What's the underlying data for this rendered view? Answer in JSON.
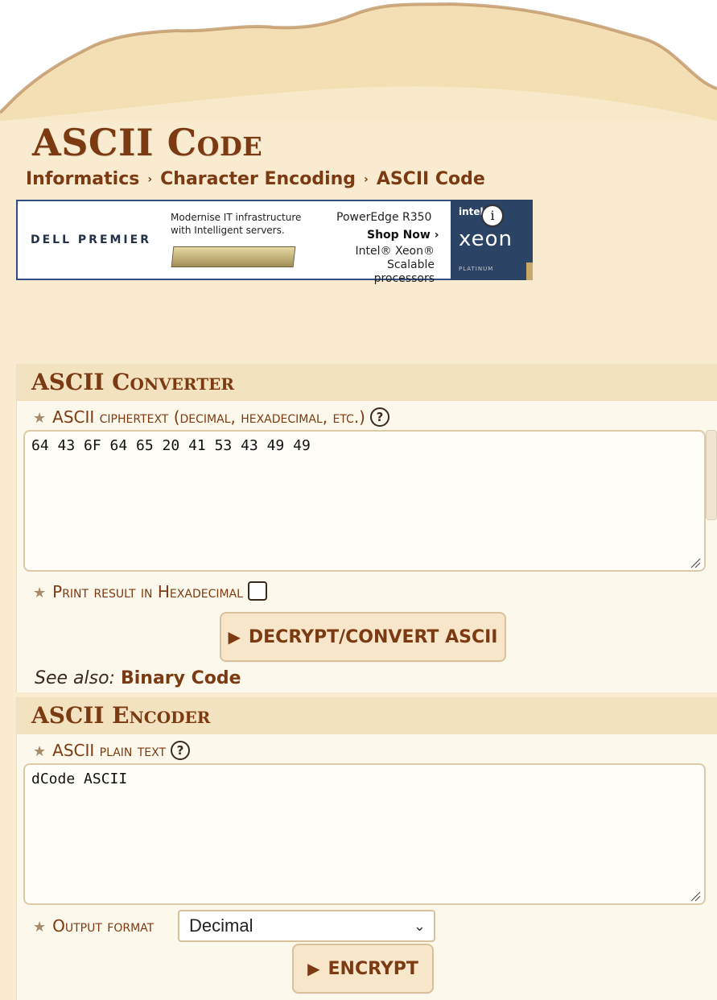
{
  "page": {
    "title": "ASCII Code",
    "breadcrumb": [
      "Informatics",
      "Character Encoding",
      "ASCII Code"
    ]
  },
  "ad": {
    "brand": "DELL PREMIER",
    "tagline": "Modernise IT infrastructure with Intelligent servers.",
    "model": "PowerEdge R350",
    "cta": "Shop Now ›",
    "processor_line1": "Intel® Xeon®",
    "processor_line2": "Scalable processors",
    "intel": "intel",
    "xeon": "xeon",
    "platinum": "PLATINUM",
    "info_icon": "i"
  },
  "converter": {
    "heading": "ASCII Converter",
    "ciphertext_label": "ASCII ciphertext (decimal, hexadecimal, etc.)",
    "ciphertext_value": "64 43 6F 64 65 20 41 53 43 49 49",
    "hex_label": "Print result in Hexadecimal",
    "hex_checked": false,
    "button": "DECRYPT/CONVERT ASCII",
    "see_also_prefix": "See also:",
    "see_also_link": "Binary Code"
  },
  "encoder": {
    "heading": "ASCII Encoder",
    "plaintext_label": "ASCII plain text",
    "plaintext_value": "dCode ASCII",
    "output_label": "Output format",
    "output_value": "Decimal",
    "button": "ENCRYPT"
  },
  "colors": {
    "accent": "#7b3a12",
    "background": "#f8ebcf",
    "panel_head": "#f3e2bf"
  }
}
